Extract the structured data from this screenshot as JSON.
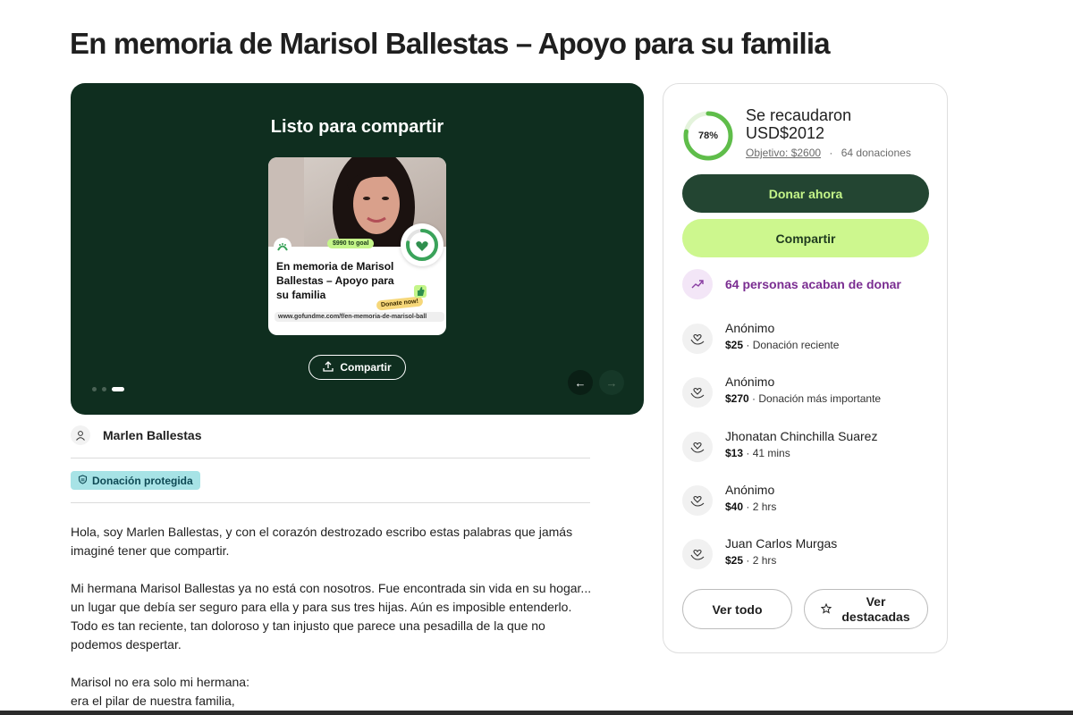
{
  "title": "En memoria de Marisol Ballestas – Apoyo para su familia",
  "hero": {
    "heading": "Listo para compartir",
    "card": {
      "goal_pill": "$990 to goal",
      "title": "En memoria de Marisol Ballestas – Apoyo para su familia",
      "donate_tag": "Donate now!",
      "url": "www.gofundme.com/f/en-memoria-de-marisol-ball"
    },
    "share_label": "Compartir",
    "prev_icon": "←",
    "next_icon": "→"
  },
  "organizer": {
    "name": "Marlen Ballestas"
  },
  "protected_label": "Donación protegida",
  "story": {
    "paragraphs": [
      "Hola, soy Marlen Ballestas, y con el corazón destrozado escribo estas palabras que jamás imaginé tener que compartir.",
      "Mi hermana Marisol Ballestas ya no está con nosotros. Fue encontrada sin vida en su hogar... un lugar que debía ser seguro para ella y para sus tres hijas. Aún es imposible entenderlo. Todo es tan reciente, tan doloroso y tan injusto que parece una pesadilla de la que no podemos despertar."
    ],
    "lines": [
      "Marisol no era solo mi hermana:",
      "era el pilar de nuestra familia,"
    ]
  },
  "summary": {
    "percent_label": "78%",
    "percent": 0.78,
    "raised_line1": "Se recaudaron",
    "raised_line2": "USD$2012",
    "goal": "Objetivo: $2600",
    "separator": "·",
    "donations": "64 donaciones"
  },
  "buttons": {
    "donate": "Donar ahora",
    "share": "Compartir",
    "see_all": "Ver todo",
    "see_top": "Ver destacadas"
  },
  "recent_activity": "64 personas acaban de donar",
  "donors": [
    {
      "name": "Anónimo",
      "amount": "$25",
      "detail": " · Donación reciente"
    },
    {
      "name": "Anónimo",
      "amount": "$270",
      "detail": " · Donación más importante"
    },
    {
      "name": "Jhonatan Chinchilla Suarez",
      "amount": "$13",
      "detail": " · 41 mins"
    },
    {
      "name": "Anónimo",
      "amount": "$40",
      "detail": " · 2 hrs"
    },
    {
      "name": "Juan Carlos Murgas",
      "amount": "$25",
      "detail": " · 2 hrs"
    }
  ],
  "colors": {
    "hero_bg": "#0f2e1f",
    "donate_bg": "#234532",
    "accent_green": "#cdf78e",
    "progress": "#5fbd4a",
    "purple": "#7a2d91"
  },
  "icons": {
    "organizer": "user-icon",
    "shield": "shield-icon",
    "share": "upload-icon",
    "trend": "trending-up-icon",
    "donor": "heart-hand-icon",
    "star": "star-icon"
  }
}
